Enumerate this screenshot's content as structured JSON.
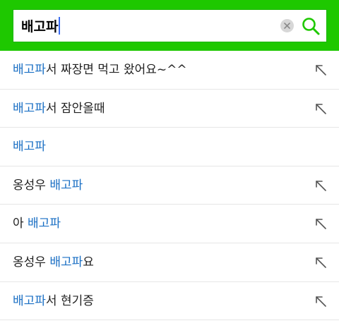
{
  "colors": {
    "header_bg": "#1ec800",
    "highlight": "#1a6fc4",
    "search_icon": "#1ec800"
  },
  "search": {
    "value": "배고파",
    "clear_icon": "clear-icon",
    "submit_icon": "search-icon"
  },
  "suggestions": [
    {
      "before": "",
      "match": "배고파",
      "after": "서 짜장면 먹고 왔어요~^^",
      "has_arrow": true
    },
    {
      "before": "",
      "match": "배고파",
      "after": "서 잠안올때",
      "has_arrow": true
    },
    {
      "before": "",
      "match": "배고파",
      "after": "",
      "has_arrow": false
    },
    {
      "before": "옹성우 ",
      "match": "배고파",
      "after": "",
      "has_arrow": true
    },
    {
      "before": "아 ",
      "match": "배고파",
      "after": "",
      "has_arrow": true
    },
    {
      "before": "옹성우 ",
      "match": "배고파",
      "after": "요",
      "has_arrow": true
    },
    {
      "before": "",
      "match": "배고파",
      "after": "서 현기증",
      "has_arrow": true
    }
  ]
}
